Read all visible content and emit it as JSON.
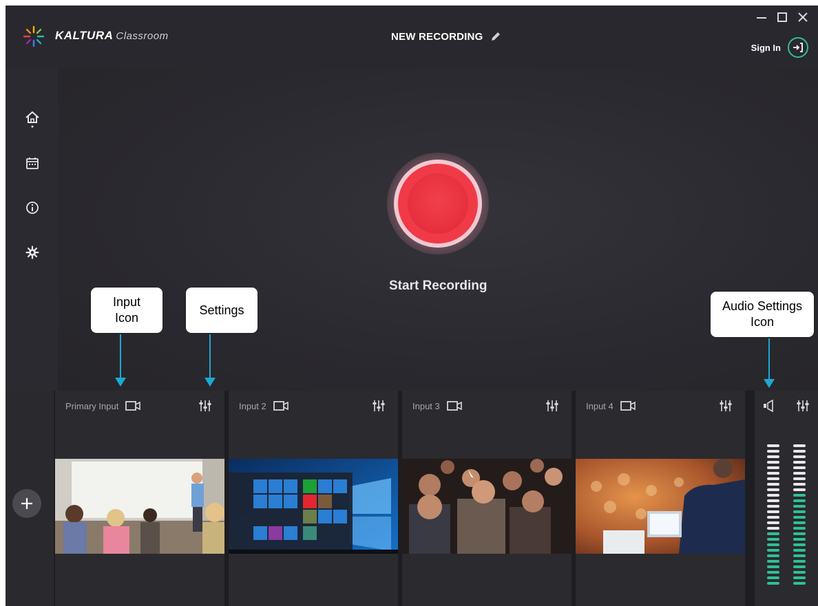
{
  "app": {
    "brand": "KALTURA",
    "brand_sub": "Classroom",
    "recording_title": "NEW RECORDING",
    "sign_in": "Sign In"
  },
  "sidebar": {
    "items": [
      {
        "icon": "home-icon"
      },
      {
        "icon": "calendar-icon"
      },
      {
        "icon": "info-icon"
      },
      {
        "icon": "gear-icon"
      }
    ]
  },
  "main": {
    "record_label": "Start Recording"
  },
  "callouts": {
    "input_icon": "Input Icon",
    "settings": "Settings",
    "audio_settings": "Audio Settings Icon"
  },
  "inputs": [
    {
      "label": "Primary Input"
    },
    {
      "label": "Input 2"
    },
    {
      "label": "Input 3"
    },
    {
      "label": "Input 4"
    }
  ],
  "audio": {
    "level_left": 0.4,
    "level_right": 0.65
  },
  "colors": {
    "accent_green": "#2fbf96",
    "record_red": "#e72f3c",
    "annotation_arrow": "#1ba8d3"
  }
}
